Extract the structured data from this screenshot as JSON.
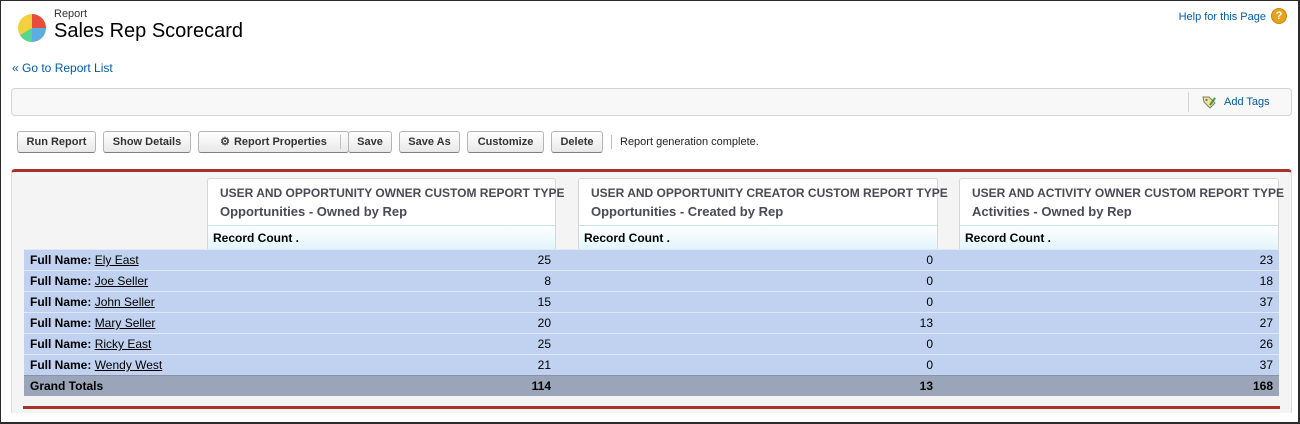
{
  "header": {
    "page_type": "Report",
    "title": "Sales Rep Scorecard",
    "help_link": "Help for this Page",
    "help_icon": "help-icon",
    "back_link": "« Go to Report List"
  },
  "tags": {
    "add_tags_label": "Add Tags",
    "icon": "tag-icon"
  },
  "toolbar": {
    "run_report": "Run Report",
    "show_details": "Show Details",
    "report_properties": "Report Properties",
    "save": "Save",
    "save_as": "Save As",
    "customize": "Customize",
    "delete": "Delete",
    "status": "Report generation complete."
  },
  "blocks": [
    {
      "report_type": "USER AND OPPORTUNITY OWNER CUSTOM REPORT TYPE",
      "name": "Opportunities - Owned by Rep",
      "column": "Record Count ."
    },
    {
      "report_type": "USER AND OPPORTUNITY CREATOR CUSTOM REPORT TYPE",
      "name": "Opportunities - Created by Rep",
      "column": "Record Count ."
    },
    {
      "report_type": "USER AND ACTIVITY OWNER CUSTOM REPORT TYPE",
      "name": "Activities - Owned by Rep",
      "column": "Record Count ."
    }
  ],
  "rows": [
    {
      "label": "Full Name:",
      "name": "Ely East",
      "values": [
        "25",
        "0",
        "23"
      ]
    },
    {
      "label": "Full Name:",
      "name": "Joe Seller",
      "values": [
        "8",
        "0",
        "18"
      ]
    },
    {
      "label": "Full Name:",
      "name": "John Seller",
      "values": [
        "15",
        "0",
        "37"
      ]
    },
    {
      "label": "Full Name:",
      "name": "Mary Seller",
      "values": [
        "20",
        "13",
        "27"
      ]
    },
    {
      "label": "Full Name:",
      "name": "Ricky East",
      "values": [
        "25",
        "0",
        "26"
      ]
    },
    {
      "label": "Full Name:",
      "name": "Wendy West",
      "values": [
        "21",
        "0",
        "37"
      ]
    }
  ],
  "totals": {
    "label": "Grand Totals",
    "values": [
      "114",
      "13",
      "168"
    ]
  },
  "colors": {
    "accent_red": "#a8322a",
    "row_blue": "#c0d2ef",
    "totals_gray": "#9ba5b9",
    "link_blue": "#015ba7"
  }
}
